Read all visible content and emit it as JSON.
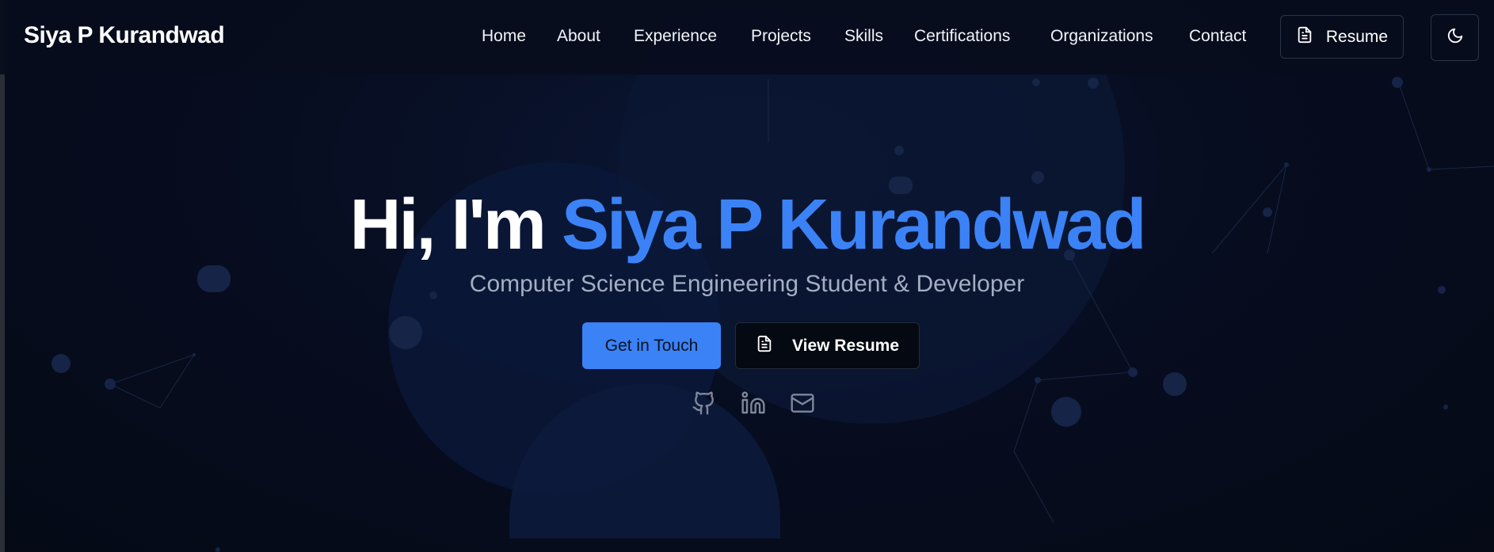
{
  "header": {
    "logo": "Siya P Kurandwad",
    "nav": [
      "Home",
      "About",
      "Experience",
      "Projects",
      "Skills",
      "Certifications",
      "Organizations",
      "Contact"
    ],
    "resume_label": "Resume",
    "resume_icon": "file-text-icon",
    "theme_icon": "moon-icon"
  },
  "hero": {
    "greeting": "Hi, I'm",
    "name": "Siya P Kurandwad",
    "subtitle": "Computer Science Engineering Student & Developer",
    "primary_button": "Get in Touch",
    "secondary_button": "View Resume",
    "socials": [
      "github-icon",
      "linkedin-icon",
      "mail-icon"
    ]
  },
  "colors": {
    "accent": "#3b82f6",
    "background": "#060b18"
  }
}
